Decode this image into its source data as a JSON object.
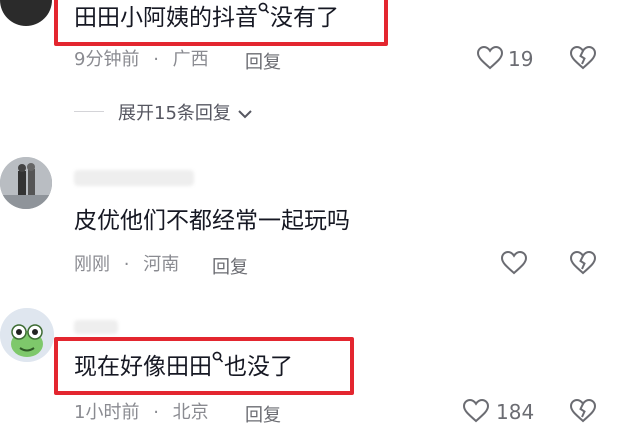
{
  "comments": [
    {
      "text_before": "田田小阿姨的抖音",
      "text_after": "没有了",
      "time": "9分钟前",
      "location": "广西",
      "reply_label": "回复",
      "like_count": "19"
    },
    {
      "text": "皮优他们不都经常一起玩吗",
      "time": "刚刚",
      "location": "河南",
      "reply_label": "回复",
      "like_count": ""
    },
    {
      "text_before": "现在好像田田",
      "text_after": "也没了",
      "time": "1小时前",
      "location": "北京",
      "reply_label": "回复",
      "like_count": "184"
    }
  ],
  "expand_replies": "展开15条回复",
  "separator": "·",
  "colors": {
    "highlight_box": "#e3262f",
    "muted_text": "#8a8b91"
  }
}
